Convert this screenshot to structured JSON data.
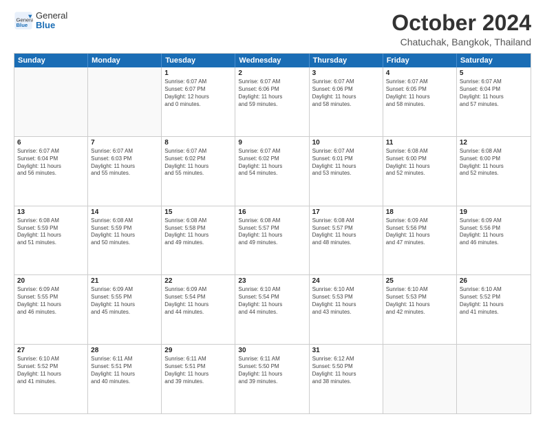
{
  "header": {
    "logo_general": "General",
    "logo_blue": "Blue",
    "title": "October 2024",
    "subtitle": "Chatuchak, Bangkok, Thailand"
  },
  "weekdays": [
    "Sunday",
    "Monday",
    "Tuesday",
    "Wednesday",
    "Thursday",
    "Friday",
    "Saturday"
  ],
  "weeks": [
    [
      {
        "day": "",
        "info": ""
      },
      {
        "day": "",
        "info": ""
      },
      {
        "day": "1",
        "info": "Sunrise: 6:07 AM\nSunset: 6:07 PM\nDaylight: 12 hours\nand 0 minutes."
      },
      {
        "day": "2",
        "info": "Sunrise: 6:07 AM\nSunset: 6:06 PM\nDaylight: 11 hours\nand 59 minutes."
      },
      {
        "day": "3",
        "info": "Sunrise: 6:07 AM\nSunset: 6:06 PM\nDaylight: 11 hours\nand 58 minutes."
      },
      {
        "day": "4",
        "info": "Sunrise: 6:07 AM\nSunset: 6:05 PM\nDaylight: 11 hours\nand 58 minutes."
      },
      {
        "day": "5",
        "info": "Sunrise: 6:07 AM\nSunset: 6:04 PM\nDaylight: 11 hours\nand 57 minutes."
      }
    ],
    [
      {
        "day": "6",
        "info": "Sunrise: 6:07 AM\nSunset: 6:04 PM\nDaylight: 11 hours\nand 56 minutes."
      },
      {
        "day": "7",
        "info": "Sunrise: 6:07 AM\nSunset: 6:03 PM\nDaylight: 11 hours\nand 55 minutes."
      },
      {
        "day": "8",
        "info": "Sunrise: 6:07 AM\nSunset: 6:02 PM\nDaylight: 11 hours\nand 55 minutes."
      },
      {
        "day": "9",
        "info": "Sunrise: 6:07 AM\nSunset: 6:02 PM\nDaylight: 11 hours\nand 54 minutes."
      },
      {
        "day": "10",
        "info": "Sunrise: 6:07 AM\nSunset: 6:01 PM\nDaylight: 11 hours\nand 53 minutes."
      },
      {
        "day": "11",
        "info": "Sunrise: 6:08 AM\nSunset: 6:00 PM\nDaylight: 11 hours\nand 52 minutes."
      },
      {
        "day": "12",
        "info": "Sunrise: 6:08 AM\nSunset: 6:00 PM\nDaylight: 11 hours\nand 52 minutes."
      }
    ],
    [
      {
        "day": "13",
        "info": "Sunrise: 6:08 AM\nSunset: 5:59 PM\nDaylight: 11 hours\nand 51 minutes."
      },
      {
        "day": "14",
        "info": "Sunrise: 6:08 AM\nSunset: 5:59 PM\nDaylight: 11 hours\nand 50 minutes."
      },
      {
        "day": "15",
        "info": "Sunrise: 6:08 AM\nSunset: 5:58 PM\nDaylight: 11 hours\nand 49 minutes."
      },
      {
        "day": "16",
        "info": "Sunrise: 6:08 AM\nSunset: 5:57 PM\nDaylight: 11 hours\nand 49 minutes."
      },
      {
        "day": "17",
        "info": "Sunrise: 6:08 AM\nSunset: 5:57 PM\nDaylight: 11 hours\nand 48 minutes."
      },
      {
        "day": "18",
        "info": "Sunrise: 6:09 AM\nSunset: 5:56 PM\nDaylight: 11 hours\nand 47 minutes."
      },
      {
        "day": "19",
        "info": "Sunrise: 6:09 AM\nSunset: 5:56 PM\nDaylight: 11 hours\nand 46 minutes."
      }
    ],
    [
      {
        "day": "20",
        "info": "Sunrise: 6:09 AM\nSunset: 5:55 PM\nDaylight: 11 hours\nand 46 minutes."
      },
      {
        "day": "21",
        "info": "Sunrise: 6:09 AM\nSunset: 5:55 PM\nDaylight: 11 hours\nand 45 minutes."
      },
      {
        "day": "22",
        "info": "Sunrise: 6:09 AM\nSunset: 5:54 PM\nDaylight: 11 hours\nand 44 minutes."
      },
      {
        "day": "23",
        "info": "Sunrise: 6:10 AM\nSunset: 5:54 PM\nDaylight: 11 hours\nand 44 minutes."
      },
      {
        "day": "24",
        "info": "Sunrise: 6:10 AM\nSunset: 5:53 PM\nDaylight: 11 hours\nand 43 minutes."
      },
      {
        "day": "25",
        "info": "Sunrise: 6:10 AM\nSunset: 5:53 PM\nDaylight: 11 hours\nand 42 minutes."
      },
      {
        "day": "26",
        "info": "Sunrise: 6:10 AM\nSunset: 5:52 PM\nDaylight: 11 hours\nand 41 minutes."
      }
    ],
    [
      {
        "day": "27",
        "info": "Sunrise: 6:10 AM\nSunset: 5:52 PM\nDaylight: 11 hours\nand 41 minutes."
      },
      {
        "day": "28",
        "info": "Sunrise: 6:11 AM\nSunset: 5:51 PM\nDaylight: 11 hours\nand 40 minutes."
      },
      {
        "day": "29",
        "info": "Sunrise: 6:11 AM\nSunset: 5:51 PM\nDaylight: 11 hours\nand 39 minutes."
      },
      {
        "day": "30",
        "info": "Sunrise: 6:11 AM\nSunset: 5:50 PM\nDaylight: 11 hours\nand 39 minutes."
      },
      {
        "day": "31",
        "info": "Sunrise: 6:12 AM\nSunset: 5:50 PM\nDaylight: 11 hours\nand 38 minutes."
      },
      {
        "day": "",
        "info": ""
      },
      {
        "day": "",
        "info": ""
      }
    ]
  ]
}
